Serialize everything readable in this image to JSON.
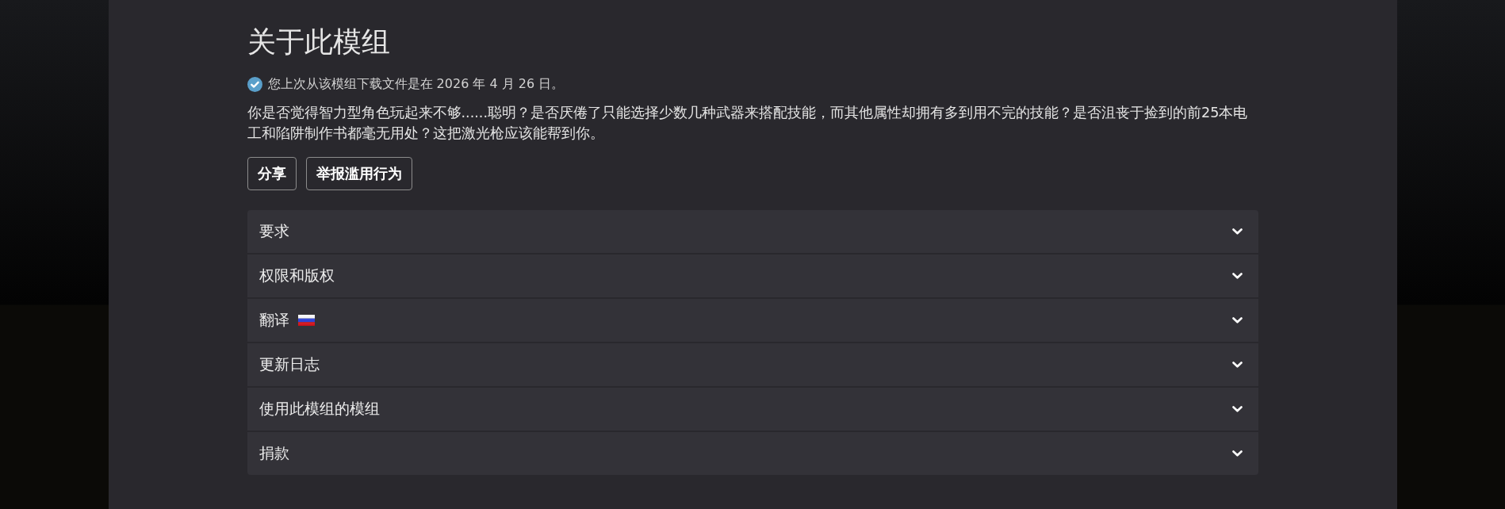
{
  "page": {
    "title": "关于此模组",
    "download_notice": "您上次从该模组下载文件是在 2026 年 4 月 26 日。",
    "description": "你是否觉得智力型角色玩起来不够......聪明？是否厌倦了只能选择少数几种武器来搭配技能，而其他属性却拥有多到用不完的技能？是否沮丧于捡到的前25本电工和陷阱制作书都毫无用处？这把激光枪应该能帮到你。"
  },
  "buttons": [
    {
      "label": "分享"
    },
    {
      "label": "举报滥用行为"
    }
  ],
  "sections": [
    {
      "label": "要求",
      "kind": "plain",
      "expanded": false
    },
    {
      "label": "权限和版权",
      "kind": "plain",
      "expanded": false
    },
    {
      "label": "翻译",
      "kind": "flag",
      "expanded": false
    },
    {
      "label": "更新日志",
      "kind": "plain",
      "expanded": false
    },
    {
      "label": "使用此模组的模组",
      "kind": "plain",
      "expanded": false
    },
    {
      "label": "捐款",
      "kind": "plain",
      "expanded": false
    }
  ]
}
